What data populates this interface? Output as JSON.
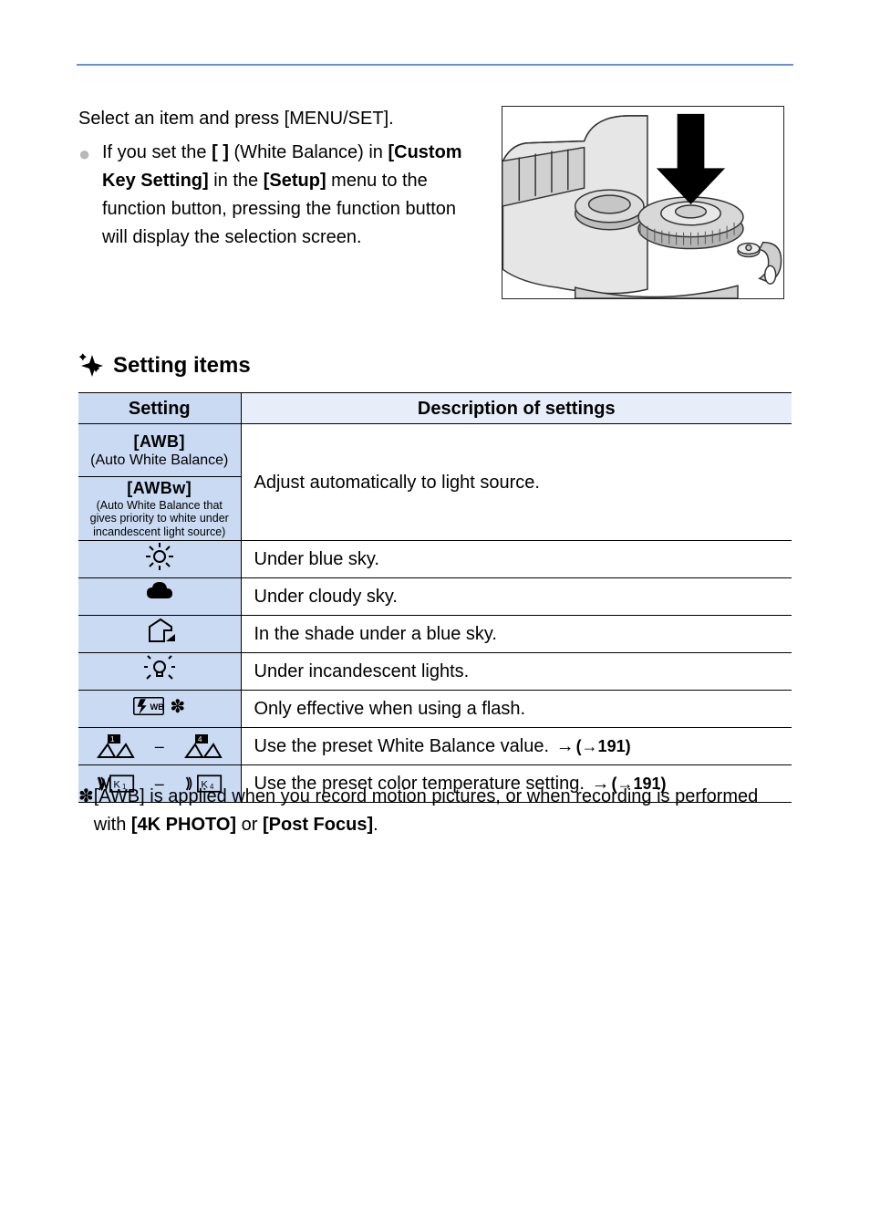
{
  "intro": {
    "line": "Select an item and press [MENU/SET].",
    "note_prefix": "If you set the ",
    "note_bold1": "[   ]",
    "note_mid": " (White Balance) in ",
    "note_bold2": "[Custom Key Setting]",
    "note_suffix1": " in the ",
    "note_bold3": "[Setup]",
    "note_suffix2": " menu to the function button, pressing the function button will display the selection screen."
  },
  "section_title": "Setting items",
  "table": {
    "headers": {
      "setting": "Setting",
      "desc": "Description of settings"
    },
    "rows": [
      {
        "setting_type": "awb",
        "awb_code": "[AWB]",
        "awb_label": "(Auto White Balance)",
        "desc": "Adjust automatically to light source.",
        "rowspan_desc": true
      },
      {
        "setting_type": "awbw",
        "awb_code": "[AWBw]",
        "awb_label": "(Auto White Balance that gives priority to white under incandescent light source)"
      },
      {
        "setting_type": "icon",
        "icon": "sun",
        "label_attr": "daylight-icon",
        "desc": "Under blue sky."
      },
      {
        "setting_type": "icon",
        "icon": "cloud",
        "label_attr": "cloudy-icon",
        "desc": "Under cloudy sky."
      },
      {
        "setting_type": "icon",
        "icon": "shade",
        "label_attr": "shade-icon",
        "desc": "In the shade under a blue sky."
      },
      {
        "setting_type": "icon",
        "icon": "lamp",
        "label_attr": "incandescent-icon",
        "desc": "Under incandescent lights."
      },
      {
        "setting_type": "flashwb",
        "label_attr": "flash-wb-icon",
        "desc": "Only effective when using a flash."
      },
      {
        "setting_type": "wbset",
        "label_attr": "wb-preset-icon",
        "desc_prefix": "Use the preset White Balance value. ",
        "xref": "(→191)"
      },
      {
        "setting_type": "ct",
        "label_attr": "color-temp-icon",
        "desc_prefix": "Use the preset color temperature setting. ",
        "xref": "(→191)"
      }
    ]
  },
  "footnote": {
    "mark": "*",
    "text_prefix": "[AWB] is applied when you record motion pictures, or when recording is performed with ",
    "bold1": "[4K PHOTO]",
    "mid": " or ",
    "bold2": "[Post Focus]",
    "suffix": "."
  }
}
